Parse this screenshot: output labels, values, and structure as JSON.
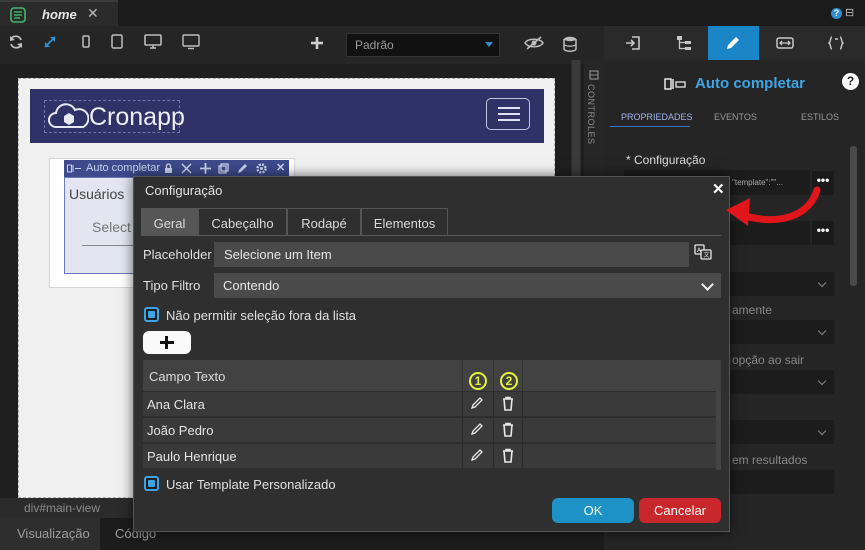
{
  "tabbar": {
    "tab_label": "home",
    "close": "✕",
    "help": "?",
    "minimize": "⊟"
  },
  "toolbar": {
    "icons": [
      "refresh-icon",
      "resize-icon",
      "phone-icon",
      "tablet-icon",
      "desktop-icon",
      "monitor-icon",
      "plus-icon",
      "eye-off-icon",
      "database-icon"
    ],
    "device_select": "Padrão"
  },
  "canvas": {
    "logo_text": "Cronapp",
    "autocomplete_toolbar": "Auto completar",
    "usuarios": "Usuários",
    "select_placeholder": "Select",
    "controls_label": "CONTROLES"
  },
  "bottom": {
    "breadcrumb": "div#main-view",
    "tab_visualizacao": "Visualização",
    "tab_codigo": "Código"
  },
  "right_panel": {
    "title": "Auto completar",
    "help": "?",
    "subtabs": [
      "PROPRIEDADES",
      "EVENTOS",
      "ESTILOS"
    ],
    "config_label": "* Configuração",
    "config_value": "\"template\":\"\"...",
    "dots": "•••",
    "partial_labels": [
      "amente",
      "opção ao sair",
      "em resultados"
    ]
  },
  "modal": {
    "title": "Configuração",
    "close": "✕",
    "tabs": [
      "Geral",
      "Cabeçalho",
      "Rodapé",
      "Elementos"
    ],
    "placeholder_label": "Placeholder",
    "placeholder_value": "Selecione um Item",
    "tipo_filtro_label": "Tipo Filtro",
    "tipo_filtro_value": "Contendo",
    "nao_permitir_label": "Não permitir seleção fora da lista",
    "grid": {
      "header": "Campo Texto",
      "rows": [
        {
          "text": "Ana Clara"
        },
        {
          "text": "João Pedro"
        },
        {
          "text": "Paulo Henrique"
        }
      ],
      "markers": [
        "1",
        "2"
      ]
    },
    "usar_template_label": "Usar Template Personalizado",
    "ok": "OK",
    "cancel": "Cancelar"
  },
  "colors": {
    "accent": "#1a85c7",
    "ok": "#1c92c6",
    "cancel": "#c8282b",
    "arrow": "#e0161b",
    "marker": "#e7f23a"
  }
}
